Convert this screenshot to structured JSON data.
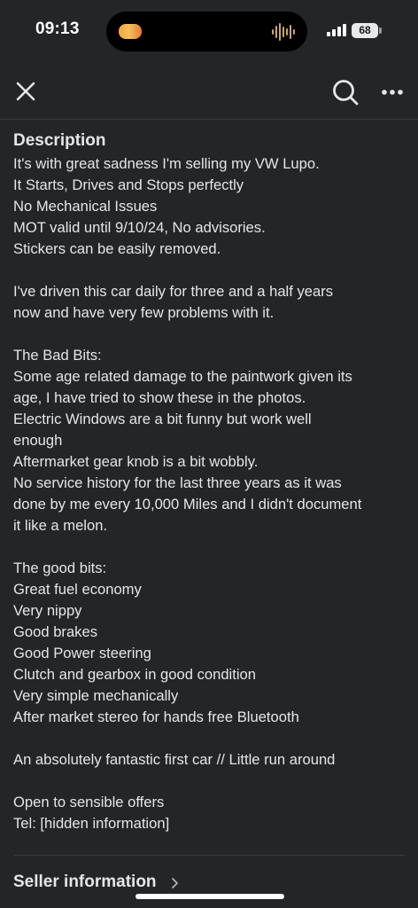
{
  "status_bar": {
    "time": "09:13",
    "battery": "68"
  },
  "nav": {
    "close_icon": "close-icon",
    "search_icon": "search-icon",
    "more_icon": "more-horizontal-icon"
  },
  "description": {
    "title": "Description",
    "lines": [
      "It's with great sadness I'm selling my VW Lupo.",
      "It Starts, Drives and Stops perfectly",
      "No Mechanical Issues",
      "MOT valid until 9/10/24, No advisories.",
      "Stickers can be easily removed.",
      "",
      "I've driven this car daily for three and a half years",
      "now and have very few problems with it.",
      "",
      "The Bad Bits:",
      "Some age related damage to the paintwork given its",
      "age, I have tried to show these in the photos.",
      "Electric Windows are a bit funny but work well",
      "enough",
      "Aftermarket gear knob is a bit wobbly.",
      "No service history for the last three years as it was",
      "done by me every 10,000 Miles and I didn't document",
      "it like a melon.",
      "",
      "The good bits:",
      "Great fuel economy",
      "Very nippy",
      "Good brakes",
      "Good Power steering",
      "Clutch and gearbox in good condition",
      "Very simple mechanically",
      "After market stereo for hands free Bluetooth",
      "",
      "An absolutely fantastic first car // Little run around",
      "",
      "Open to sensible offers",
      "Tel: [hidden information]"
    ]
  },
  "seller": {
    "label": "Seller information",
    "chevron_icon": "chevron-right-icon"
  }
}
